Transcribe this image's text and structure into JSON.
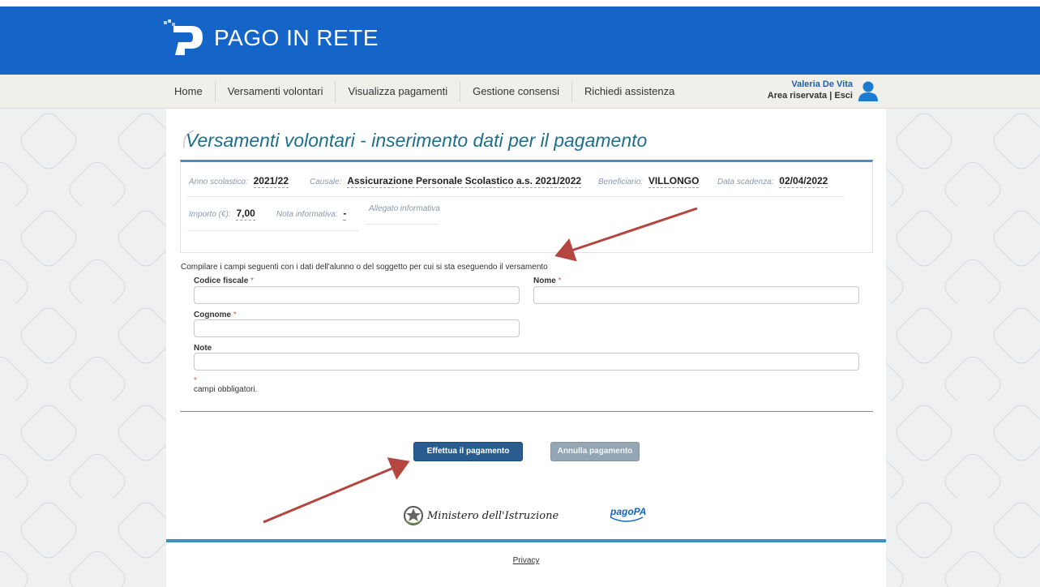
{
  "app": {
    "brand": "PAGO IN RETE"
  },
  "nav": {
    "items": [
      {
        "label": "Home"
      },
      {
        "label": "Versamenti volontari"
      },
      {
        "label": "Visualizza pagamenti"
      },
      {
        "label": "Gestione consensi"
      },
      {
        "label": "Richiedi assistenza"
      }
    ],
    "user_name": "Valeria De Vita",
    "user_links": "Area riservata | Esci"
  },
  "page": {
    "title": "Versamenti volontari - inserimento dati per il pagamento"
  },
  "info": {
    "anno_label": "Anno scolastico:",
    "anno_value": "2021/22",
    "causale_label": "Causale:",
    "causale_value": "Assicurazione Personale Scolastico a.s. 2021/2022",
    "beneficiario_label": "Beneficiario:",
    "beneficiario_value": "VILLONGO",
    "scadenza_label": "Data scadenza:",
    "scadenza_value": "02/04/2022",
    "importo_label": "Importo (€):",
    "importo_value": "7,00",
    "nota_label": "Nota informativa:",
    "nota_value": "-",
    "allegato_label": "Allegato informativa"
  },
  "form": {
    "instructions": "Compilare i campi seguenti con i dati dell'alunno o del soggetto per cui si sta eseguendo il versamento",
    "codice_fiscale_label": "Codice fiscale",
    "nome_label": "Nome",
    "cognome_label": "Cognome",
    "note_label": "Note",
    "required_star": "*",
    "required_note": "campi obbligatori.",
    "codice_fiscale_value": "",
    "nome_value": "",
    "cognome_value": "",
    "note_value": ""
  },
  "actions": {
    "pay_label": "Effettua il pagamento",
    "cancel_label": "Annulla pagamento"
  },
  "footer": {
    "ministero": "Ministero dell'Istruzione",
    "pagopa": "pagoPA",
    "privacy": "Privacy"
  },
  "colors": {
    "brand_blue": "#1565c9",
    "title_teal": "#1e6e8c",
    "pay_button": "#2a5d8f",
    "cancel_button": "#94a5b3",
    "annotation_arrow": "#b5453f"
  }
}
